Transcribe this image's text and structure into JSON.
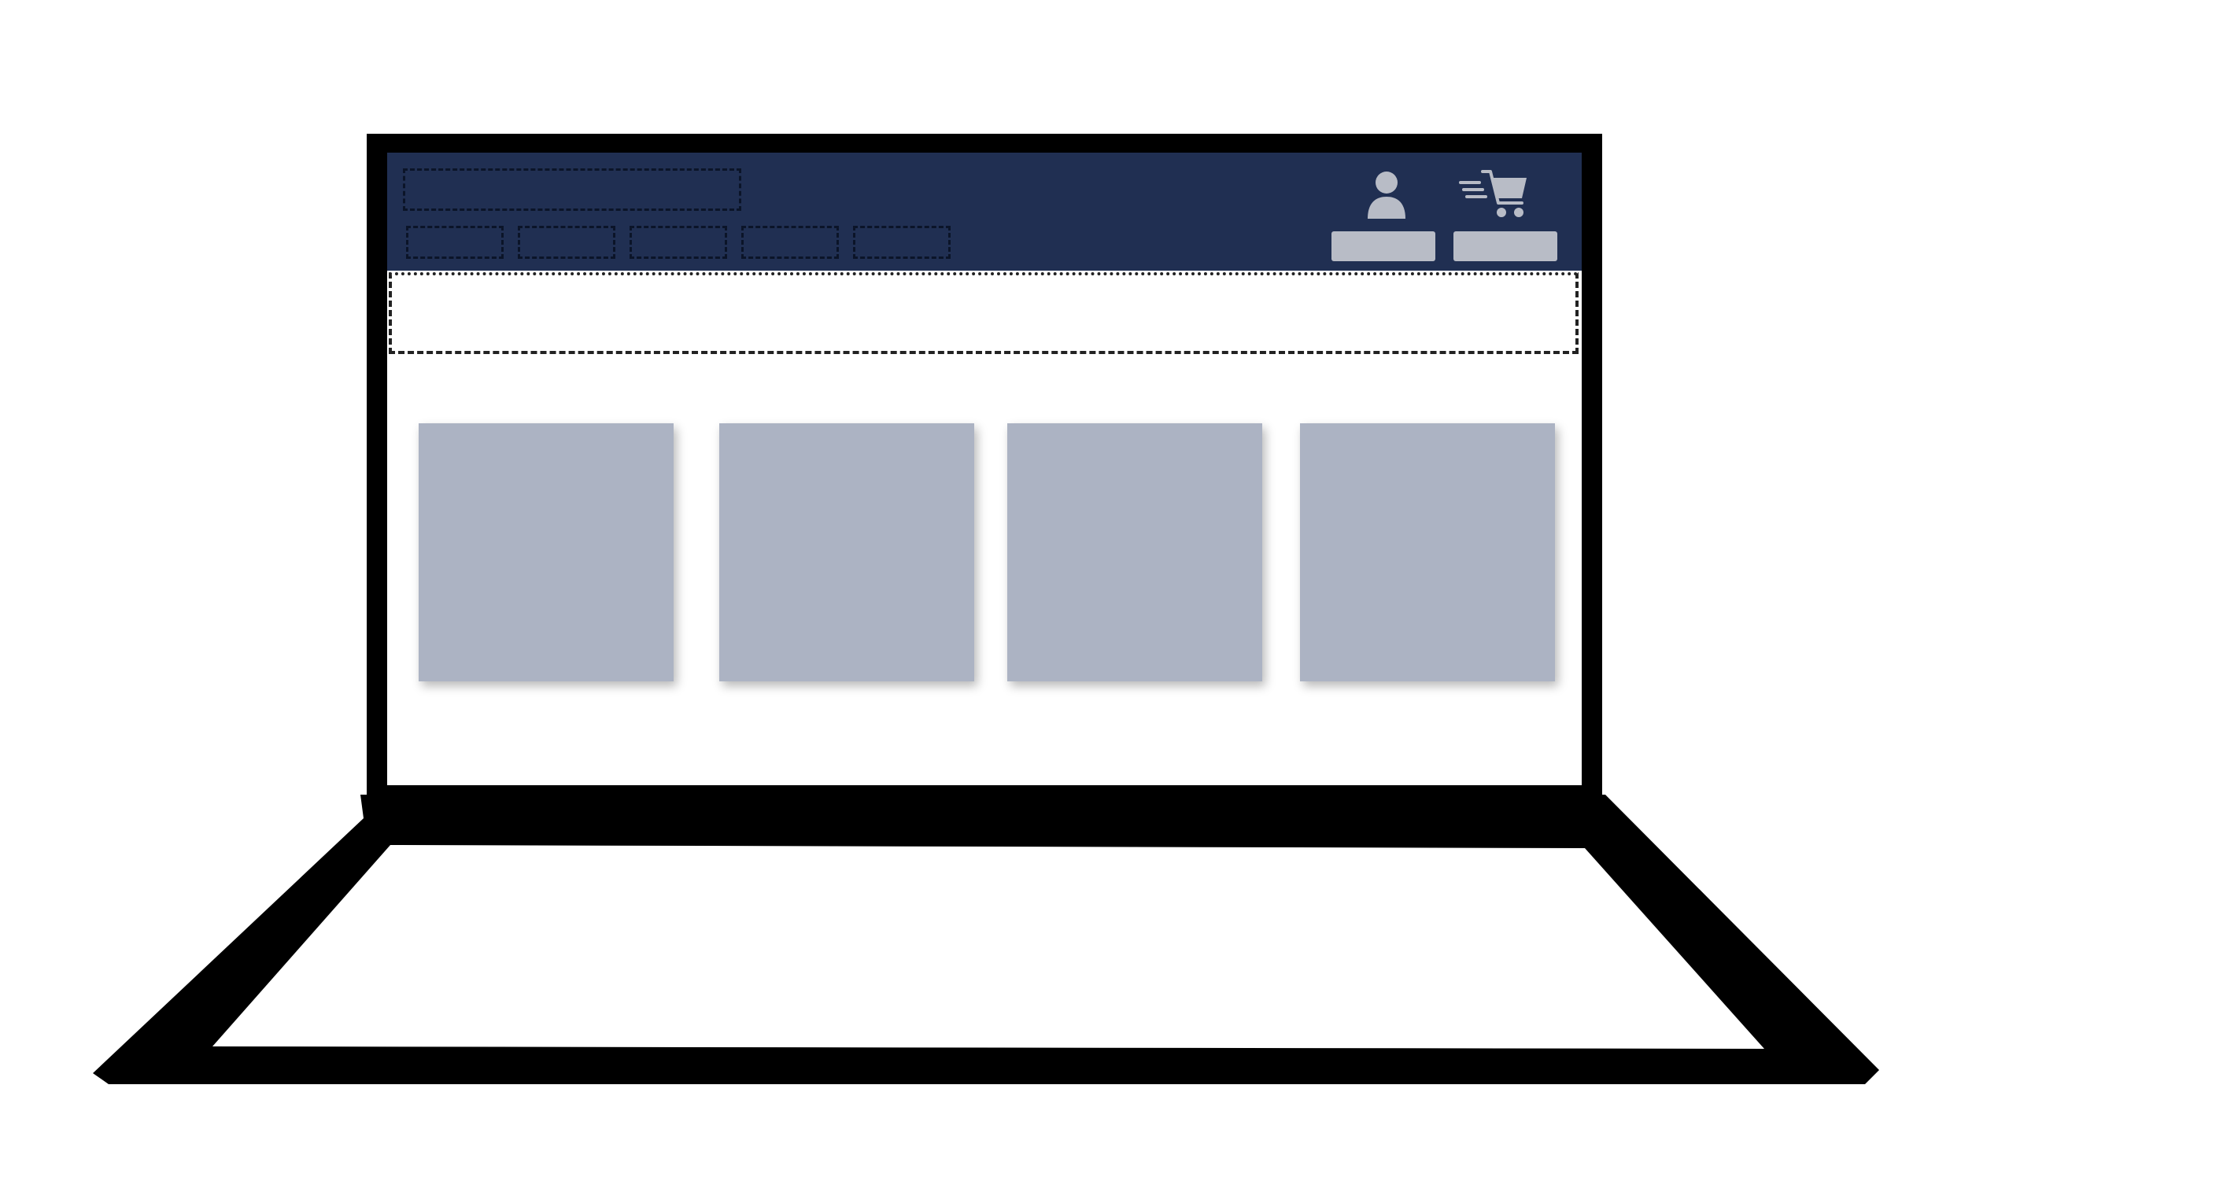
{
  "colors": {
    "header_bg": "#202f52",
    "icon_gray": "#b8bcc6",
    "button_gray": "#b8bcc6",
    "product_placeholder": "#acb3c3",
    "laptop_frame": "#000000",
    "screen_bg": "#ffffff",
    "placeholder_outline": "#0b1428"
  },
  "header": {
    "logo": {
      "label": ""
    },
    "nav_items": [
      {
        "label": ""
      },
      {
        "label": ""
      },
      {
        "label": ""
      },
      {
        "label": ""
      },
      {
        "label": ""
      }
    ],
    "account": {
      "icon": "user-icon",
      "button_label": ""
    },
    "cart": {
      "icon": "shopping-cart-icon",
      "button_label": ""
    }
  },
  "banner": {
    "label": ""
  },
  "products": [
    {
      "title": ""
    },
    {
      "title": ""
    },
    {
      "title": ""
    },
    {
      "title": ""
    }
  ]
}
